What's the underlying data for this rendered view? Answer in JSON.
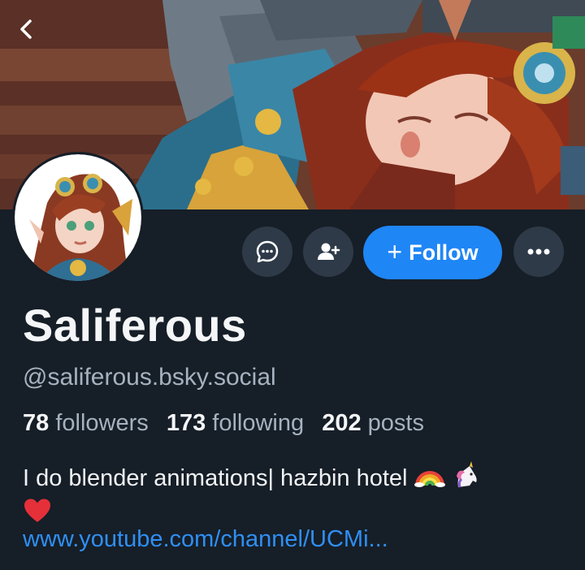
{
  "profile": {
    "display_name": "Saliferous",
    "handle": "@saliferous.bsky.social",
    "stats": {
      "followers_count": "78",
      "followers_label": "followers",
      "following_count": "173",
      "following_label": "following",
      "posts_count": "202",
      "posts_label": "posts"
    },
    "bio_text": "I do blender animations| hazbin hotel",
    "bio_emojis": [
      "rainbow",
      "unicorn",
      "red-heart"
    ],
    "link": "www.youtube.com/channel/UCMi..."
  },
  "actions": {
    "follow_label": "Follow",
    "follow_plus": "+"
  },
  "icons": {
    "back": "chevron-left-icon",
    "message": "chat-bubble-icon",
    "suggest": "person-plus-icon",
    "more": "ellipsis-icon"
  },
  "colors": {
    "background": "#161e27",
    "accent": "#1f86f5",
    "secondary_button": "#2e3a48",
    "muted_text": "#a6b2c0",
    "link": "#2f8ff5"
  }
}
